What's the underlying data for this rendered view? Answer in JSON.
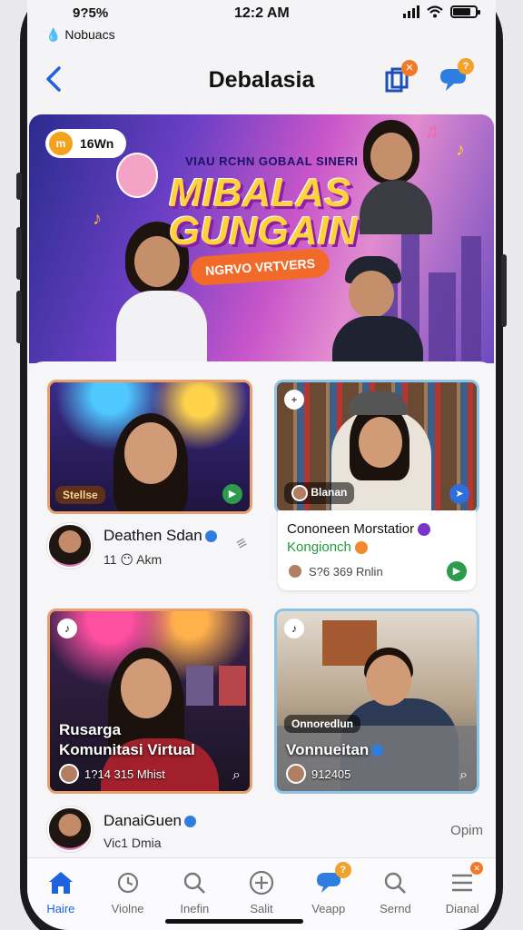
{
  "status_bar": {
    "left_text": "9?5%",
    "carrier": "Nobuacs",
    "time": "12:2 AM"
  },
  "header": {
    "title": "Debalasia",
    "back_icon": "chevron-left-icon",
    "right_icons": [
      "layers-icon",
      "chat-bubble-icon"
    ],
    "badge_2": "?"
  },
  "banner": {
    "coin_label": "16Wn",
    "coin_glyph": "m",
    "subtitle": "VIAU RCHN GOBAAL SINERI",
    "title_line1": "MIBALAS",
    "title_line2": "GUNGAIN",
    "cta_label": "NGRVO VRTVERS",
    "accent": "#f26a2a"
  },
  "cards": [
    {
      "tag": "Stellse",
      "author_name": "Deathen Sdan",
      "author_meta_count": "11",
      "author_meta_text": "Akm"
    },
    {
      "tag": "Blanan",
      "title_line1": "Cononeen Morstatior",
      "title_line2": "Kongionch",
      "meta": "S?6 369 Rnlin"
    },
    {
      "title_line1": "Rusarga",
      "title_line2": "Komunitasi Virtual",
      "meta": "1?14 315 Mhist"
    },
    {
      "tag": "Onnoredlun",
      "title": "Vonnueitan",
      "meta": "912405"
    }
  ],
  "bottom_user": {
    "name": "DanaiGuen",
    "meta": "Vic1 Dmia",
    "right_label": "Opim"
  },
  "nav": [
    {
      "label": "Haire",
      "icon": "home-icon",
      "active": true
    },
    {
      "label": "Violne",
      "icon": "clock-icon",
      "active": false
    },
    {
      "label": "Inefin",
      "icon": "search-icon",
      "active": false
    },
    {
      "label": "Salit",
      "icon": "plus-circle-icon",
      "active": false
    },
    {
      "label": "Veapp",
      "icon": "chat-bubble-icon",
      "active": false
    },
    {
      "label": "Sernd",
      "icon": "search-icon",
      "active": false
    },
    {
      "label": "Dianal",
      "icon": "menu-icon",
      "active": false
    }
  ]
}
